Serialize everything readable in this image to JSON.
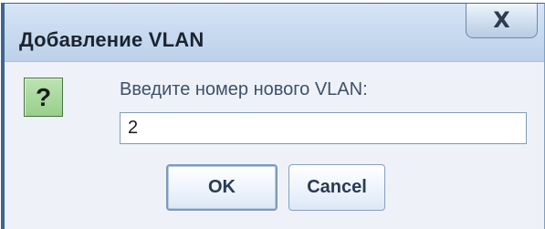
{
  "dialog": {
    "title": "Добавление VLAN",
    "close_icon": "close-icon",
    "close_symbol": "X",
    "prompt": "Введите номер нового VLAN:",
    "input_value": "2",
    "question_icon": "question-icon",
    "question_symbol": "?",
    "buttons": {
      "ok": "OK",
      "cancel": "Cancel"
    }
  }
}
